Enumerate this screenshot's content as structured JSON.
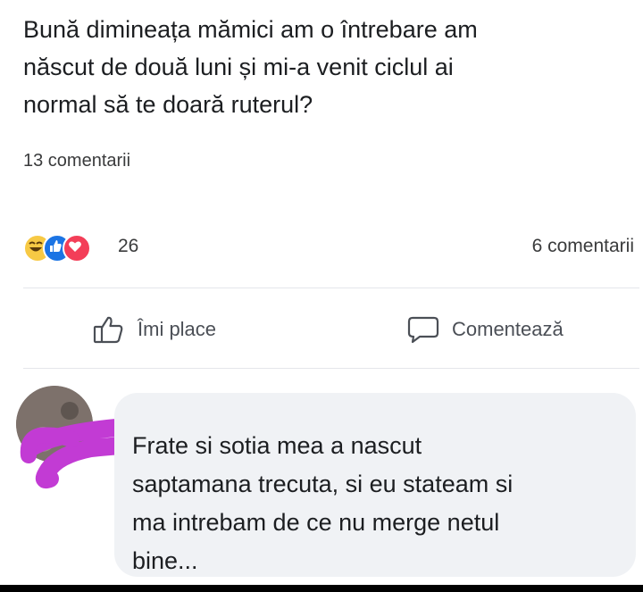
{
  "post": {
    "text": "Bună dimineața mămici am o întrebare  am\nnăscut  de două  luni și  mi-a  venit ciclul ai\nnormal să te doară  ruterul?",
    "comments_count_top": "13 comentarii"
  },
  "reactions": {
    "icons": [
      "haha-icon",
      "like-icon",
      "love-icon"
    ],
    "count": "26",
    "comments_count": "6 comentarii"
  },
  "actions": {
    "like_label": "Îmi place",
    "comment_label": "Comentează"
  },
  "comment": {
    "text": "Frate si sotia mea a nascut\nsaptamana trecuta, si eu stateam si\nma intrebam de ce nu merge netul\nbine..."
  },
  "colors": {
    "scribble": "#c23bd4",
    "bubble": "#f0f2f5",
    "like_blue": "#1b74e4",
    "love_red": "#f33e58",
    "haha_yellow": "#f7c944"
  }
}
